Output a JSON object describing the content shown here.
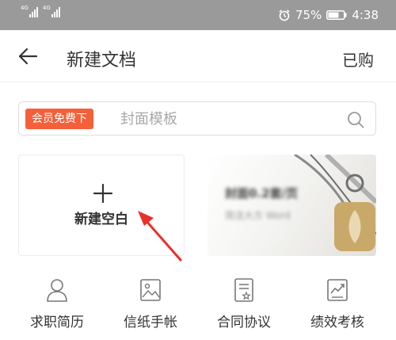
{
  "status_bar": {
    "network_1": "4G",
    "network_2": "4G",
    "battery": "75%",
    "time": "4:38",
    "icons": [
      "signal-icon",
      "alarm-icon",
      "battery-icon"
    ]
  },
  "header": {
    "title": "新建文档",
    "right_label": "已购",
    "back_icon": "back-arrow-icon"
  },
  "search": {
    "tag_label": "会员免费下",
    "placeholder": "封面模板",
    "icon": "search-icon"
  },
  "blank_card": {
    "label": "新建空白",
    "icon": "plus-icon"
  },
  "cover_card": {
    "title": "封面0.2套/页",
    "subtitle": "简洁大方 Word"
  },
  "categories": [
    {
      "label": "求职简历",
      "icon": "person-icon"
    },
    {
      "label": "信纸手帐",
      "icon": "image-icon"
    },
    {
      "label": "合同协议",
      "icon": "document-star-icon"
    },
    {
      "label": "绩效考核",
      "icon": "chart-icon"
    }
  ],
  "colors": {
    "accent": "#f4603a",
    "status_bar": "#9a9a9a",
    "annotation_arrow": "#e8312a"
  }
}
